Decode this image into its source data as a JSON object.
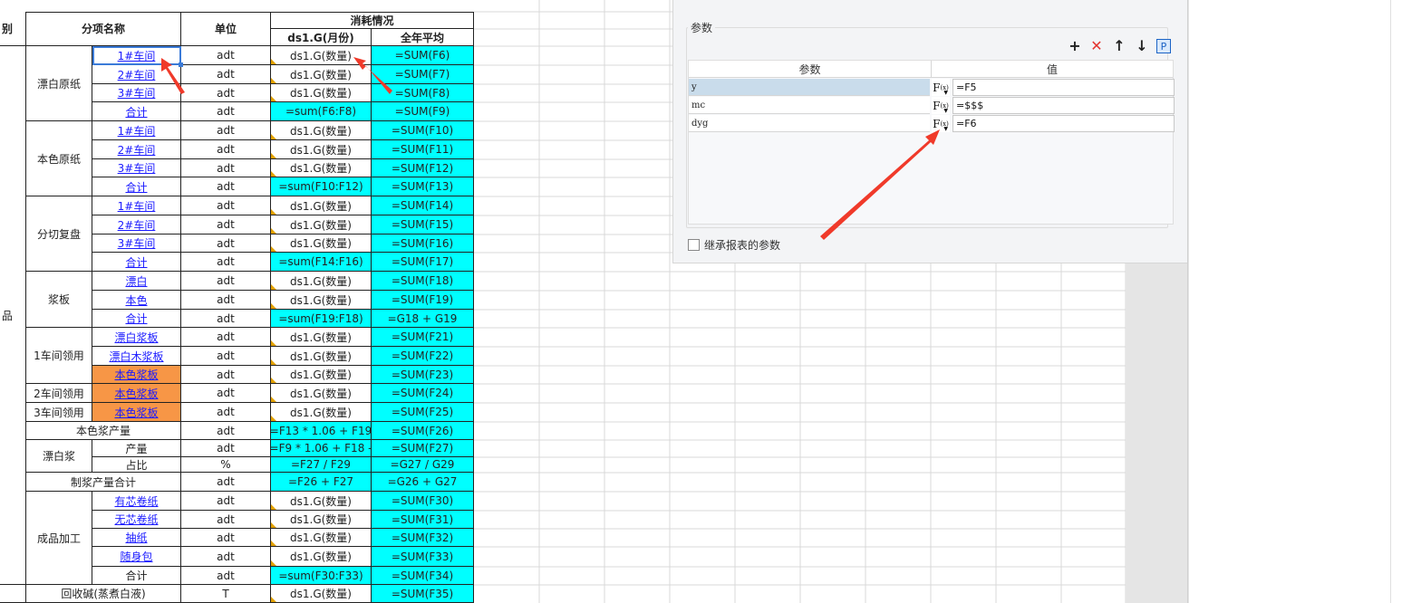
{
  "sheet": {
    "header": {
      "col_a_partial": "别",
      "name": "分项名称",
      "unit": "单位",
      "consumption": "消耗情况",
      "month": "ds1.G(月份)",
      "year_avg": "全年平均",
      "side_marker": "品"
    },
    "rows": [
      {
        "group": "漂白原纸",
        "item": "1#车间",
        "unit": "adt",
        "f": "ds1.G(数量)",
        "g": "=SUM(F6)"
      },
      {
        "group": "",
        "item": "2#车间",
        "unit": "adt",
        "f": "ds1.G(数量)",
        "g": "=SUM(F7)"
      },
      {
        "group": "",
        "item": "3#车间",
        "unit": "adt",
        "f": "ds1.G(数量)",
        "g": "=SUM(F8)"
      },
      {
        "group": "",
        "item": "合计",
        "unit": "adt",
        "f": "=sum(F6:F8)",
        "g": "=SUM(F9)"
      },
      {
        "group": "本色原纸",
        "item": "1#车间",
        "unit": "adt",
        "f": "ds1.G(数量)",
        "g": "=SUM(F10)"
      },
      {
        "group": "",
        "item": "2#车间",
        "unit": "adt",
        "f": "ds1.G(数量)",
        "g": "=SUM(F11)"
      },
      {
        "group": "",
        "item": "3#车间",
        "unit": "adt",
        "f": "ds1.G(数量)",
        "g": "=SUM(F12)"
      },
      {
        "group": "",
        "item": "合计",
        "unit": "adt",
        "f": "=sum(F10:F12)",
        "g": "=SUM(F13)"
      },
      {
        "group": "分切复盘",
        "item": "1#车间",
        "unit": "adt",
        "f": "ds1.G(数量)",
        "g": "=SUM(F14)"
      },
      {
        "group": "",
        "item": "2#车间",
        "unit": "adt",
        "f": "ds1.G(数量)",
        "g": "=SUM(F15)"
      },
      {
        "group": "",
        "item": "3#车间",
        "unit": "adt",
        "f": "ds1.G(数量)",
        "g": "=SUM(F16)"
      },
      {
        "group": "",
        "item": "合计",
        "unit": "adt",
        "f": "=sum(F14:F16)",
        "g": "=SUM(F17)"
      },
      {
        "group": "浆板",
        "item": "漂白",
        "unit": "adt",
        "f": "ds1.G(数量)",
        "g": "=SUM(F18)"
      },
      {
        "group": "",
        "item": "本色",
        "unit": "adt",
        "f": "ds1.G(数量)",
        "g": "=SUM(F19)"
      },
      {
        "group": "",
        "item": "合计",
        "unit": "adt",
        "f": "=sum(F19:F18)",
        "g": "=G18 + G19"
      },
      {
        "group": "1车间领用",
        "item": "漂白浆板",
        "unit": "adt",
        "f": "ds1.G(数量)",
        "g": "=SUM(F21)"
      },
      {
        "group": "",
        "item": "漂白木浆板",
        "unit": "adt",
        "f": "ds1.G(数量)",
        "g": "=SUM(F22)"
      },
      {
        "group": "",
        "item": "本色浆板",
        "unit": "adt",
        "f": "ds1.G(数量)",
        "g": "=SUM(F23)"
      },
      {
        "group": "2车间领用",
        "item": "本色浆板",
        "unit": "adt",
        "f": "ds1.G(数量)",
        "g": "=SUM(F24)"
      },
      {
        "group": "3车间领用",
        "item": "本色浆板",
        "unit": "adt",
        "f": "ds1.G(数量)",
        "g": "=SUM(F25)"
      },
      {
        "group": "本色浆产量",
        "item": "",
        "unit": "adt",
        "f": "=F13 * 1.06 + F19",
        "g": "=SUM(F26)"
      },
      {
        "group": "漂白浆",
        "item": "产量",
        "unit": "adt",
        "f": "=F9 * 1.06 + F18 -",
        "g": "=SUM(F27)"
      },
      {
        "group": "",
        "item": "占比",
        "unit": "%",
        "f": "=F27 / F29",
        "g": "=G27 / G29"
      },
      {
        "group": "制浆产量合计",
        "item": "",
        "unit": "adt",
        "f": "=F26 + F27",
        "g": "=G26 + G27"
      },
      {
        "group": "成品加工",
        "item": "有芯卷纸",
        "unit": "adt",
        "f": "ds1.G(数量)",
        "g": "=SUM(F30)"
      },
      {
        "group": "",
        "item": "无芯卷纸",
        "unit": "adt",
        "f": "ds1.G(数量)",
        "g": "=SUM(F31)"
      },
      {
        "group": "",
        "item": "抽纸",
        "unit": "adt",
        "f": "ds1.G(数量)",
        "g": "=SUM(F32)"
      },
      {
        "group": "",
        "item": "随身包",
        "unit": "adt",
        "f": "ds1.G(数量)",
        "g": "=SUM(F33)"
      },
      {
        "group": "",
        "item": "合计",
        "unit": "adt",
        "f": "=sum(F30:F33)",
        "g": "=SUM(F34)"
      },
      {
        "group": "回收碱(蒸煮白液)",
        "item": "",
        "unit": "T",
        "f": "ds1.G(数量)",
        "g": "=SUM(F35)"
      }
    ]
  },
  "dialog": {
    "group_title": "参数",
    "toolbar": {
      "add": "+",
      "delete": "✕",
      "up": "↑",
      "down": "↓",
      "p": "P"
    },
    "columns": {
      "param": "参数",
      "value": "值"
    },
    "params": [
      {
        "name": "y",
        "fx": "F",
        "fx_sub": "(x)",
        "value": "=F5"
      },
      {
        "name": "mc",
        "fx": "F",
        "fx_sub": "(x)",
        "value": "=$$$"
      },
      {
        "name": "dyg",
        "fx": "F",
        "fx_sub": "(x)",
        "value": "=F6"
      }
    ],
    "inherit_label": "继承报表的参数"
  },
  "colors": {
    "cyan": "#00ffff",
    "orange": "#f79646",
    "link": "#1a1aff",
    "arrow": "#f03a2a"
  }
}
